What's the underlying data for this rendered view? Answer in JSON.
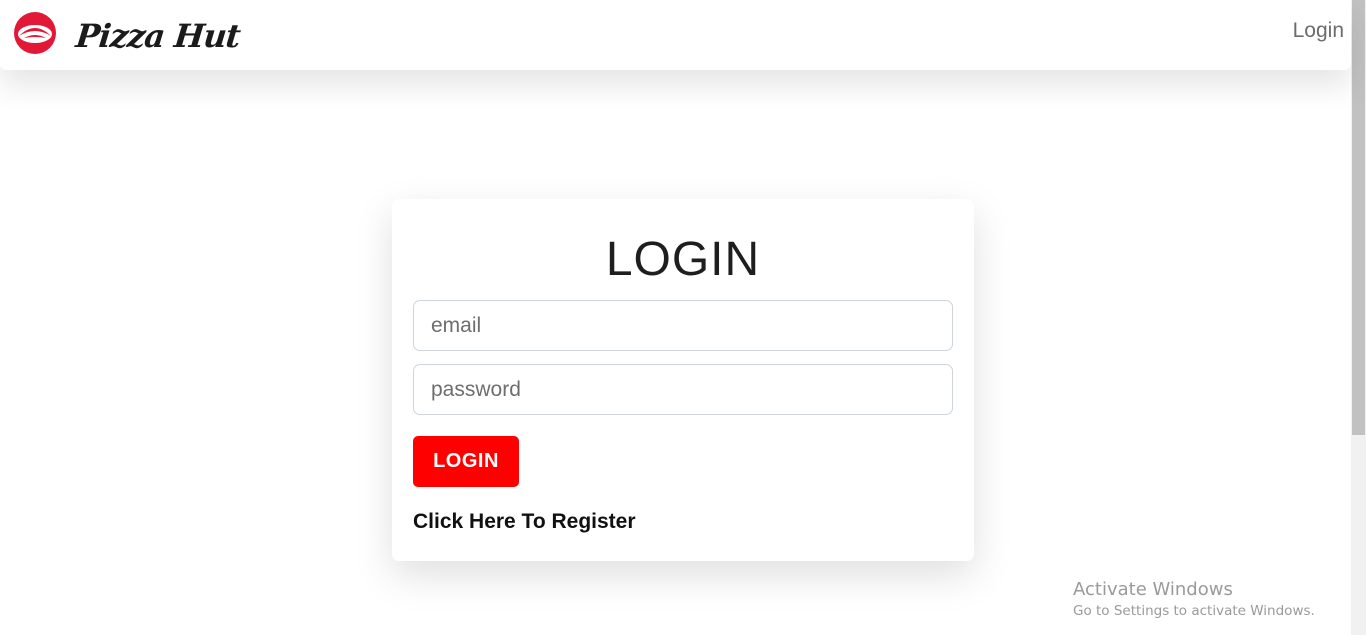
{
  "navbar": {
    "brand_name": "Pizza Hut",
    "login_link": "Login"
  },
  "login_card": {
    "title": "LOGIN",
    "email_placeholder": "email",
    "password_placeholder": "password",
    "submit_label": "LOGIN",
    "register_link": "Click Here To Register"
  },
  "windows_watermark": {
    "title": "Activate Windows",
    "subtitle": "Go to Settings to activate Windows."
  },
  "colors": {
    "brand_red": "#E31837",
    "button_red": "#FF0000"
  },
  "icons": {
    "logo": "pizza-hut-roof-logo-icon"
  }
}
